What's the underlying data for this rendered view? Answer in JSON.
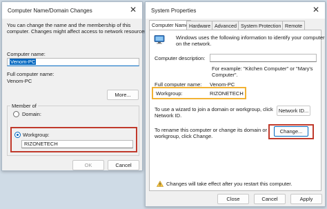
{
  "left_dialog": {
    "title": "Computer Name/Domain Changes",
    "intro": [
      "You can change the name and the membership of this",
      "computer. Changes might affect access to network resources."
    ],
    "computer_name_label": "Computer name:",
    "computer_name_value": "Venom-PC",
    "full_name_label": "Full computer name:",
    "full_name_value": "Venom-PC",
    "more_button": "More...",
    "member_of_label": "Member of",
    "domain_label": "Domain:",
    "workgroup_label": "Workgroup:",
    "workgroup_value": "RIZONETECH",
    "ok_button": "OK",
    "cancel_button": "Cancel"
  },
  "right_dialog": {
    "title": "System Properties",
    "tabs": [
      "Computer Name",
      "Hardware",
      "Advanced",
      "System Protection",
      "Remote"
    ],
    "intro": [
      "Windows uses the following information to identify your computer",
      "on the network."
    ],
    "description_label": "Computer description:",
    "description_value": "",
    "example": [
      "For example: \"Kitchen Computer\" or \"Mary's",
      "Computer\"."
    ],
    "full_name_label": "Full computer name:",
    "full_name_value": "Venom-PC",
    "workgroup_label": "Workgroup:",
    "workgroup_value": "RIZONETECH",
    "wizard_text": [
      "To use a wizard to join a domain or workgroup, click",
      "Network ID."
    ],
    "network_id_button": "Network ID...",
    "rename_text": [
      "To rename this computer or change its domain or",
      "workgroup, click Change."
    ],
    "change_button": "Change...",
    "warning_text": "Changes will take effect after you restart this computer.",
    "close_button": "Close",
    "cancel_button": "Cancel",
    "apply_button": "Apply"
  },
  "colors": {
    "highlight_red": "#c0392b",
    "highlight_orange": "#f2b233",
    "accent": "#0067c0"
  }
}
